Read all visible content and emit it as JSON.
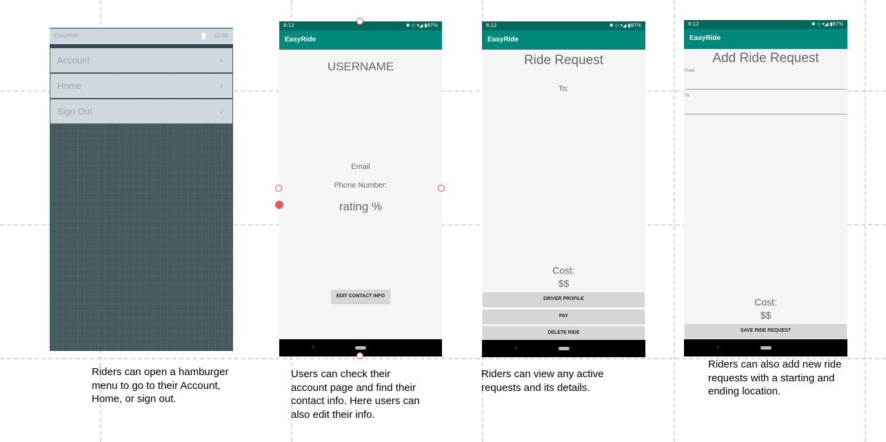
{
  "screens": {
    "menu": {
      "app_name": "EasyRide",
      "time": "12:30",
      "items": [
        {
          "label": "Account",
          "chevron": "›"
        },
        {
          "label": "Home",
          "chevron": "›"
        },
        {
          "label": "Sign Out",
          "chevron": "›"
        }
      ],
      "caption": "Riders can open a hamburger menu to go to their Account, Home, or sign out."
    },
    "account": {
      "status_time": "6:12",
      "status_right": "✱ ◇ ▾◢ ▮87%",
      "app_title": "EasyRide",
      "username": "USERNAME",
      "email": "Email",
      "phone": "Phone Number:",
      "rating": "rating %",
      "edit_button": "EDIT CONTACT INFO",
      "nav_back": "‹",
      "caption": "Users can check their account page and find their contact info. Here users can also edit their info."
    },
    "ride_request": {
      "status_time": "6:12",
      "status_right": "✱ ◇ ▾◢ ▮87%",
      "app_title": "EasyRide",
      "title": "Ride Request",
      "to_label": "To:",
      "cost_label": "Cost:",
      "cost_value": "$$",
      "driver_profile_button": "DRIVER PROFILE",
      "pay_button": "PAY",
      "delete_button": "DELETE RIDE",
      "nav_back": "‹",
      "caption": "Riders can view any active requests and its details."
    },
    "add_ride": {
      "status_time": "6:12",
      "status_right": "✱ ◇ ▾◢ ▮87%",
      "app_title": "EasyRide",
      "title": "Add Ride Request",
      "from_label": "From:",
      "to_label": "To:",
      "cost_label": "Cost:",
      "cost_value": "$$",
      "save_button": "SAVE RIDE REQUEST",
      "nav_back": "‹",
      "caption": "Riders can also add new ride requests with a starting and ending location."
    }
  },
  "colors": {
    "status_bar": "#00695c",
    "app_bar": "#00897b",
    "menu_overlay": "#455a5e",
    "selection_handle": "#d9534f"
  }
}
